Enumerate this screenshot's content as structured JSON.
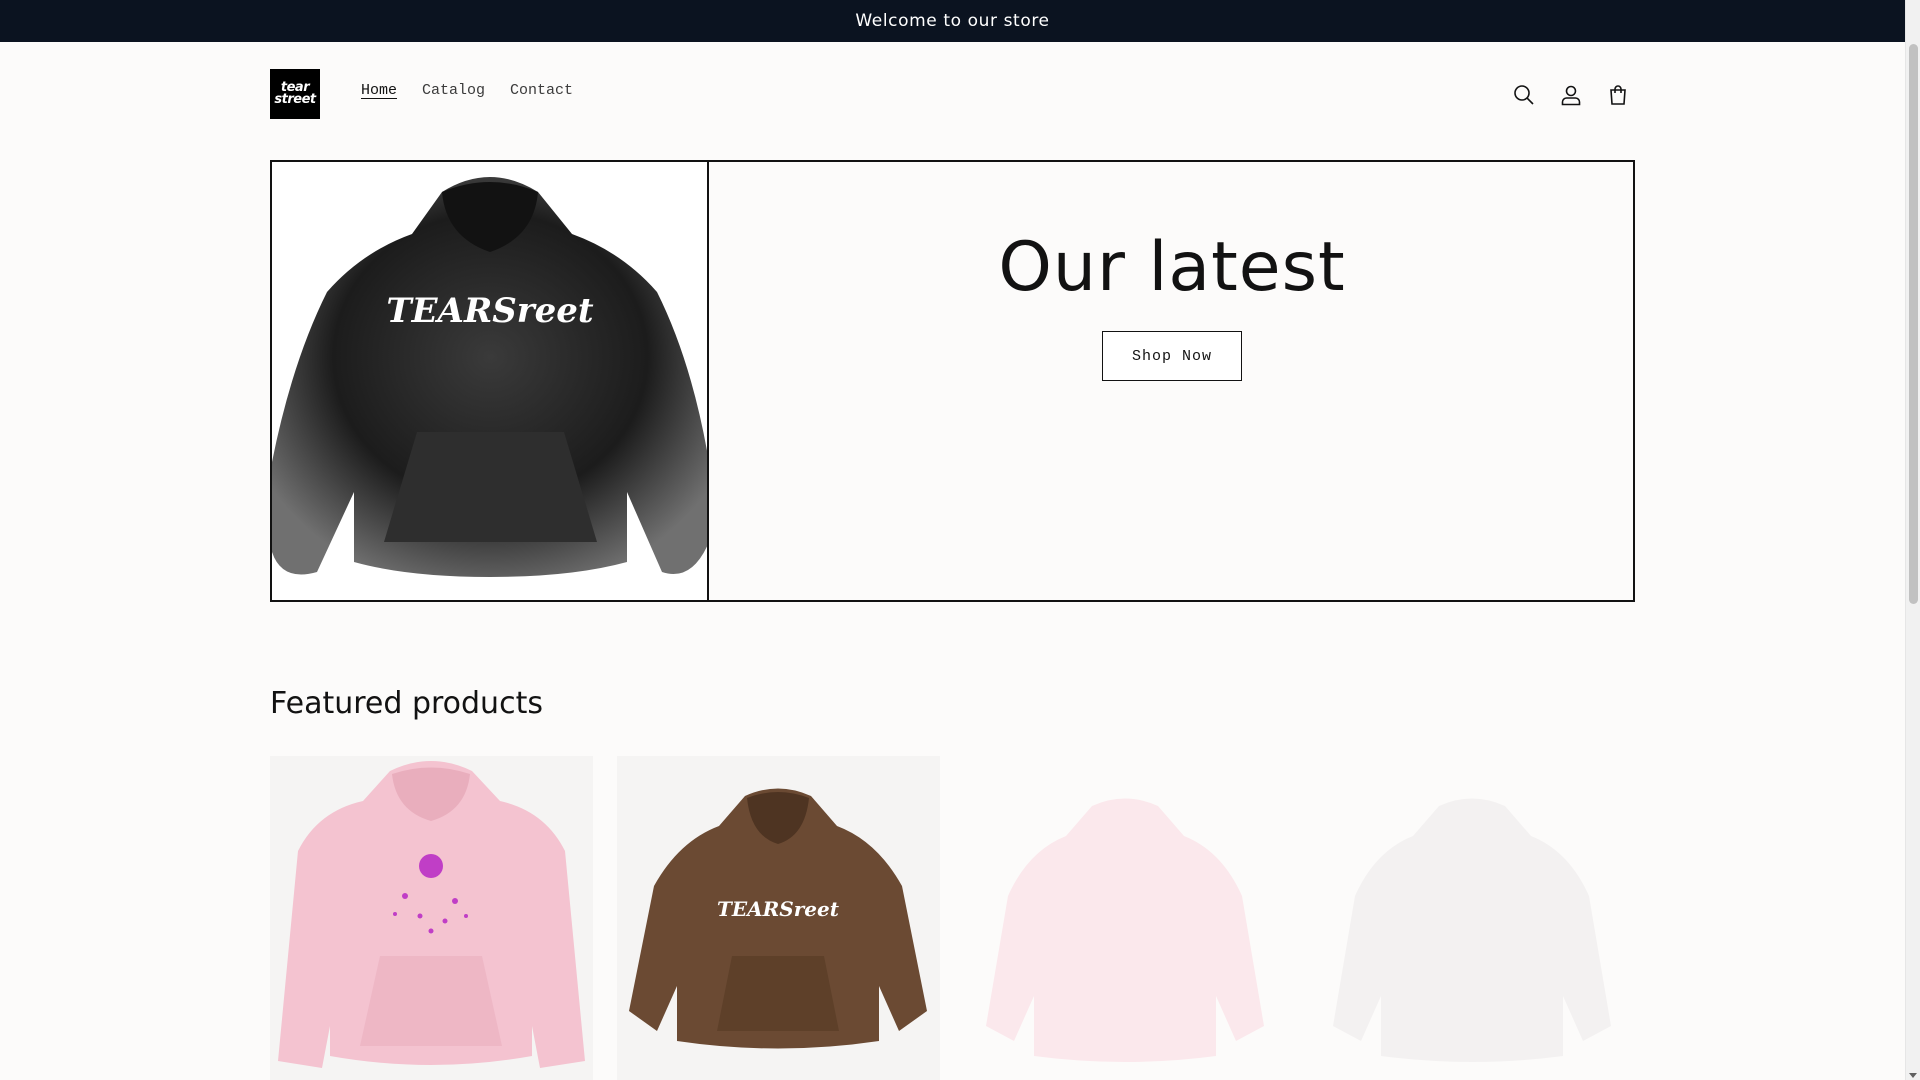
{
  "announcement": {
    "text": "Welcome to our store"
  },
  "header": {
    "logo": {
      "line1": "tear",
      "line2": "street"
    },
    "nav": [
      {
        "label": "Home",
        "active": true
      },
      {
        "label": "Catalog",
        "active": false
      },
      {
        "label": "Contact",
        "active": false
      }
    ],
    "icons": [
      "search-icon",
      "account-icon",
      "cart-icon"
    ]
  },
  "hero": {
    "title": "Our latest",
    "button_label": "Shop Now",
    "image_print": "TEARSreet"
  },
  "featured": {
    "heading": "Featured products",
    "products": [
      {
        "color": "#f4c3d0",
        "print": "pink"
      },
      {
        "color": "#6b4a33",
        "print": "TEARSreet"
      },
      {
        "color": "#fbe8ec",
        "print": "faded"
      },
      {
        "color": "#f3f1f1",
        "print": "faded"
      }
    ]
  },
  "colors": {
    "announcement_bg": "#0b1320",
    "text": "#121212",
    "page_bg": "#fcfbfa"
  }
}
